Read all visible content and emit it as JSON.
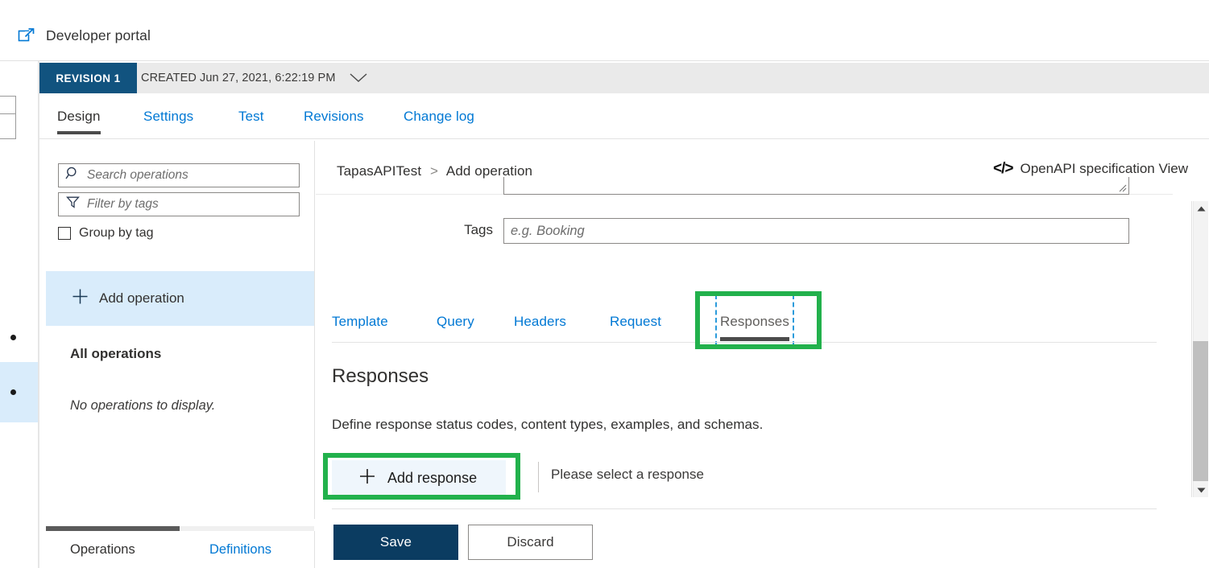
{
  "topbar": {
    "devportal_label": "Developer portal",
    "devportal_icon": "external-link-icon"
  },
  "revision": {
    "badge": "REVISION 1",
    "created_text": "CREATED Jun 27, 2021, 6:22:19 PM",
    "chevron_icon": "chevron-down-icon",
    "badge_color": "#11537f"
  },
  "main_tabs": [
    {
      "label": "Design",
      "selected": true
    },
    {
      "label": "Settings",
      "selected": false
    },
    {
      "label": "Test",
      "selected": false
    },
    {
      "label": "Revisions",
      "selected": false
    },
    {
      "label": "Change log",
      "selected": false
    }
  ],
  "left_panel": {
    "search_placeholder": "Search operations",
    "search_icon": "search-icon",
    "filter_placeholder": "Filter by tags",
    "filter_icon": "funnel-icon",
    "group_by_tag_label": "Group by tag",
    "group_by_tag_checked": false,
    "add_operation_label": "Add operation",
    "add_operation_icon": "plus-icon",
    "all_operations_label": "All operations",
    "empty_message": "No operations to display.",
    "footer_tabs": [
      {
        "label": "Operations",
        "selected": true
      },
      {
        "label": "Definitions",
        "selected": false
      }
    ]
  },
  "content": {
    "breadcrumb": {
      "root": "TapasAPITest",
      "separator": ">",
      "current": "Add operation"
    },
    "openapi_view": {
      "icon": "code-brackets-icon",
      "label": "OpenAPI specification View"
    },
    "form": {
      "tags_label": "Tags",
      "tags_placeholder": "e.g. Booking",
      "tags_value": ""
    },
    "sub_tabs": [
      {
        "label": "Template",
        "selected": false
      },
      {
        "label": "Query",
        "selected": false
      },
      {
        "label": "Headers",
        "selected": false
      },
      {
        "label": "Request",
        "selected": false
      },
      {
        "label": "Responses",
        "selected": true
      }
    ],
    "responses": {
      "title": "Responses",
      "description": "Define response status codes, content types, examples, and schemas.",
      "add_response_label": "Add response",
      "add_response_icon": "plus-icon",
      "hint": "Please select a response"
    },
    "buttons": {
      "save_label": "Save",
      "discard_label": "Discard",
      "save_color": "#0b3c61"
    }
  },
  "annotations": {
    "highlight_color": "#22b14c",
    "targets": [
      "Responses",
      "Add response"
    ]
  }
}
